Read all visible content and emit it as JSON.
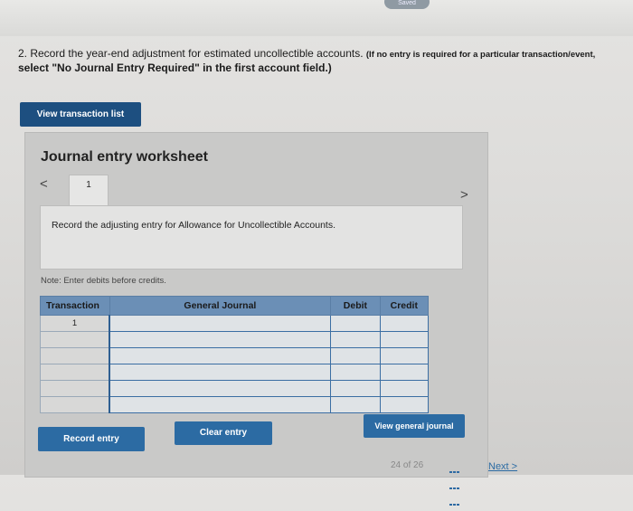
{
  "header": {
    "saved_badge": "Saved"
  },
  "instruction": {
    "main": "2. Record the year-end adjustment for estimated uncollectible accounts.",
    "note_part1": "(If no entry is required for a particular transaction/event,",
    "note_part2": "select \"No Journal Entry Required\" in the first account field.)"
  },
  "buttons": {
    "view_transaction_list": "View transaction list",
    "record_entry": "Record entry",
    "clear_entry": "Clear entry",
    "view_general_journal": "View general journal"
  },
  "worksheet": {
    "title": "Journal entry worksheet",
    "nav_prev": "<",
    "nav_next": ">",
    "tab_number": "1",
    "prompt": "Record the adjusting entry for Allowance for Uncollectible Accounts.",
    "note": "Note: Enter debits before credits."
  },
  "table": {
    "headers": [
      "Transaction",
      "General Journal",
      "Debit",
      "Credit"
    ],
    "rows": [
      {
        "transaction": "1",
        "account": "",
        "debit": "",
        "credit": ""
      },
      {
        "transaction": "",
        "account": "",
        "debit": "",
        "credit": ""
      },
      {
        "transaction": "",
        "account": "",
        "debit": "",
        "credit": ""
      },
      {
        "transaction": "",
        "account": "",
        "debit": "",
        "credit": ""
      },
      {
        "transaction": "",
        "account": "",
        "debit": "",
        "credit": ""
      },
      {
        "transaction": "",
        "account": "",
        "debit": "",
        "credit": ""
      }
    ]
  },
  "footer": {
    "page": "24 of 26",
    "next": "Next >"
  }
}
